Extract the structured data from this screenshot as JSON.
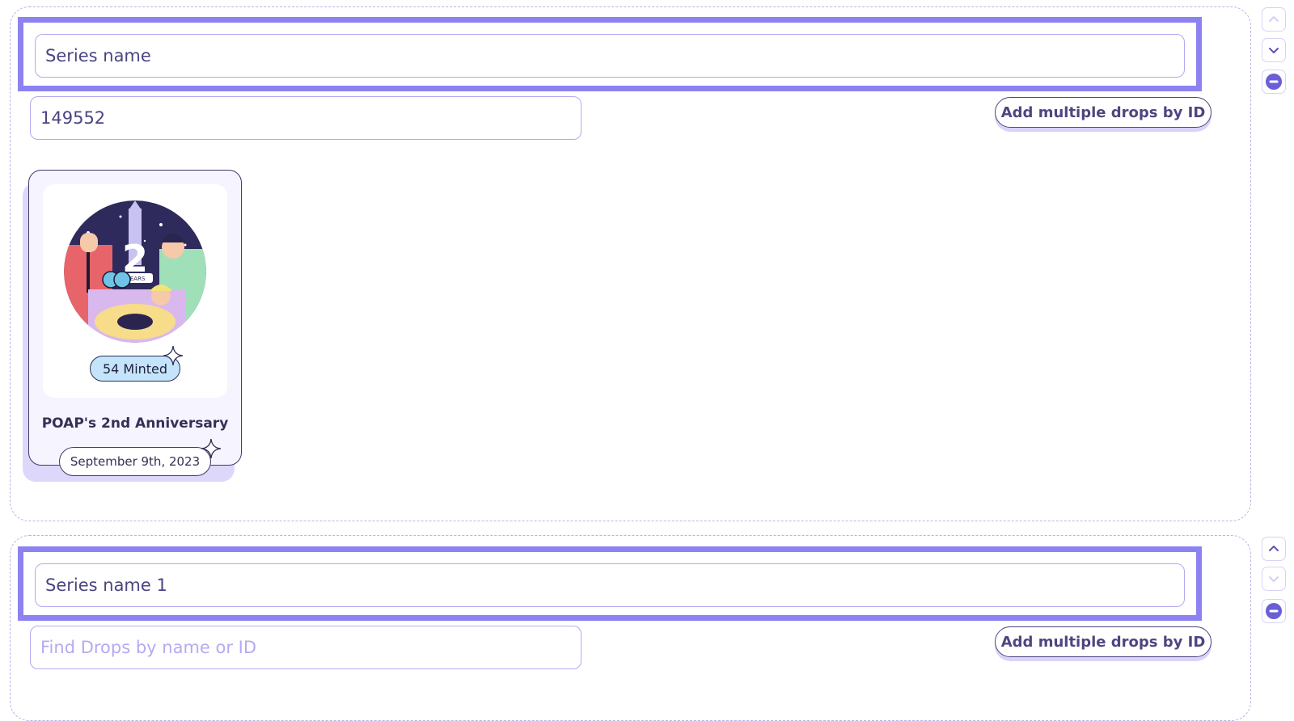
{
  "series": [
    {
      "name_value": "Series name",
      "drop_search_value": "149552",
      "drop_search_placeholder": "",
      "add_multiple_label": "Add multiple drops by ID",
      "drops": [
        {
          "title": "POAP's 2nd Anniversary",
          "minted_label": "54 Minted",
          "date": "September 9th, 2023",
          "art_text": "YEARS"
        }
      ],
      "controls": {
        "move_up_enabled": false,
        "move_down_enabled": true,
        "remove_enabled": true
      }
    },
    {
      "name_value": "Series name 1",
      "drop_search_value": "",
      "drop_search_placeholder": "Find Drops by name or ID",
      "add_multiple_label": "Add multiple drops by ID",
      "drops": [],
      "controls": {
        "move_up_enabled": true,
        "move_down_enabled": false,
        "remove_enabled": true
      }
    }
  ],
  "icons": {
    "move_up": "chevron-up-icon",
    "move_down": "chevron-down-icon",
    "remove": "minus-circle-icon",
    "sparkle": "sparkle-icon"
  },
  "colors": {
    "accent": "#8c82f2",
    "text": "#4a4580",
    "placeholder": "#b7a9f2",
    "minted_badge": "#c4e4fb",
    "card_bg": "#f6f4ff"
  }
}
